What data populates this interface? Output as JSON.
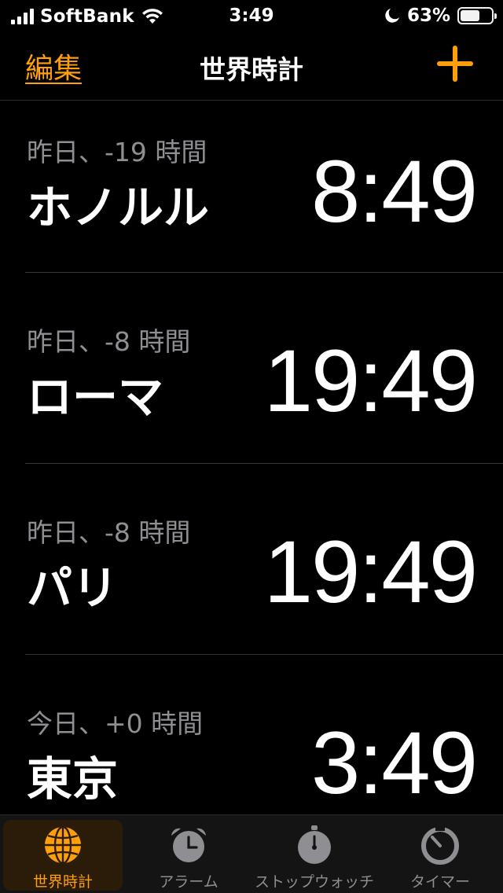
{
  "status": {
    "carrier": "SoftBank",
    "time": "3:49",
    "battery_percent_label": "63%",
    "battery_level": 0.63
  },
  "nav": {
    "edit_label": "編集",
    "title": "世界時計"
  },
  "clocks": [
    {
      "offset": "昨日、-19 時間",
      "city": "ホノルル",
      "time": "8:49"
    },
    {
      "offset": "昨日、-8 時間",
      "city": "ローマ",
      "time": "19:49"
    },
    {
      "offset": "昨日、-8 時間",
      "city": "パリ",
      "time": "19:49"
    },
    {
      "offset": "今日、+0 時間",
      "city": "東京",
      "time": "3:49"
    }
  ],
  "tabs": [
    {
      "label": "世界時計",
      "icon": "globe-icon",
      "active": true
    },
    {
      "label": "アラーム",
      "icon": "alarm-clock-icon",
      "active": false
    },
    {
      "label": "ストップウォッチ",
      "icon": "stopwatch-icon",
      "active": false
    },
    {
      "label": "タイマー",
      "icon": "timer-icon",
      "active": false
    }
  ],
  "colors": {
    "accent": "#ff9f0a",
    "secondary_text": "#8e8e93",
    "background": "#000000"
  }
}
